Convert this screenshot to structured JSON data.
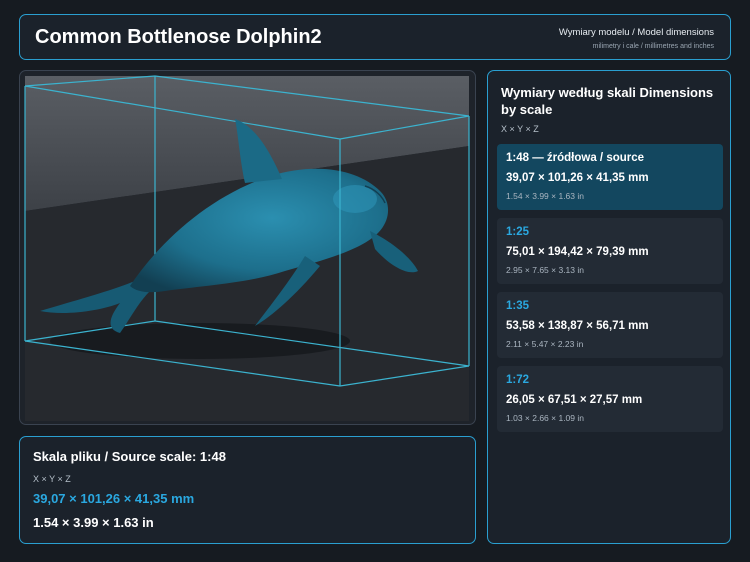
{
  "header": {
    "title": "Common Bottlenose Dolphin2",
    "subtitle": "Wymiary modelu / Model dimensions",
    "units_note": "milimetry i cale / millimetres and inches"
  },
  "viewer": {
    "colors": {
      "model": "#1d6f8c",
      "bbox": "#3bb3cf",
      "ground": "#363b42"
    }
  },
  "source_info": {
    "title": "Skala pliku / Source scale: 1:48",
    "axes": "X × Y × Z",
    "mm": "39,07 × 101,26 × 41,35 mm",
    "inches": "1.54 × 3.99 × 1.63 in"
  },
  "scales": {
    "title": "Wymiary według skali Dimensions by scale",
    "axes": "X × Y × Z",
    "items": [
      {
        "ratio": "1:48  —  źródłowa / source",
        "mm": "39,07 × 101,26 × 41,35 mm",
        "inches": "1.54 × 3.99 × 1.63 in",
        "active": true
      },
      {
        "ratio": "1:25",
        "mm": "75,01 × 194,42 × 79,39 mm",
        "inches": "2.95 × 7.65 × 3.13 in",
        "active": false
      },
      {
        "ratio": "1:35",
        "mm": "53,58 × 138,87 × 56,71 mm",
        "inches": "2.11 × 5.47 × 2.23 in",
        "active": false
      },
      {
        "ratio": "1:72",
        "mm": "26,05 × 67,51 × 27,57 mm",
        "inches": "1.03 × 2.66 × 1.09 in",
        "active": false
      }
    ]
  },
  "colors": {
    "accent": "#2aa8e0",
    "border": "#2a9fd0",
    "background": "#161b21",
    "panel": "#1b222b"
  }
}
